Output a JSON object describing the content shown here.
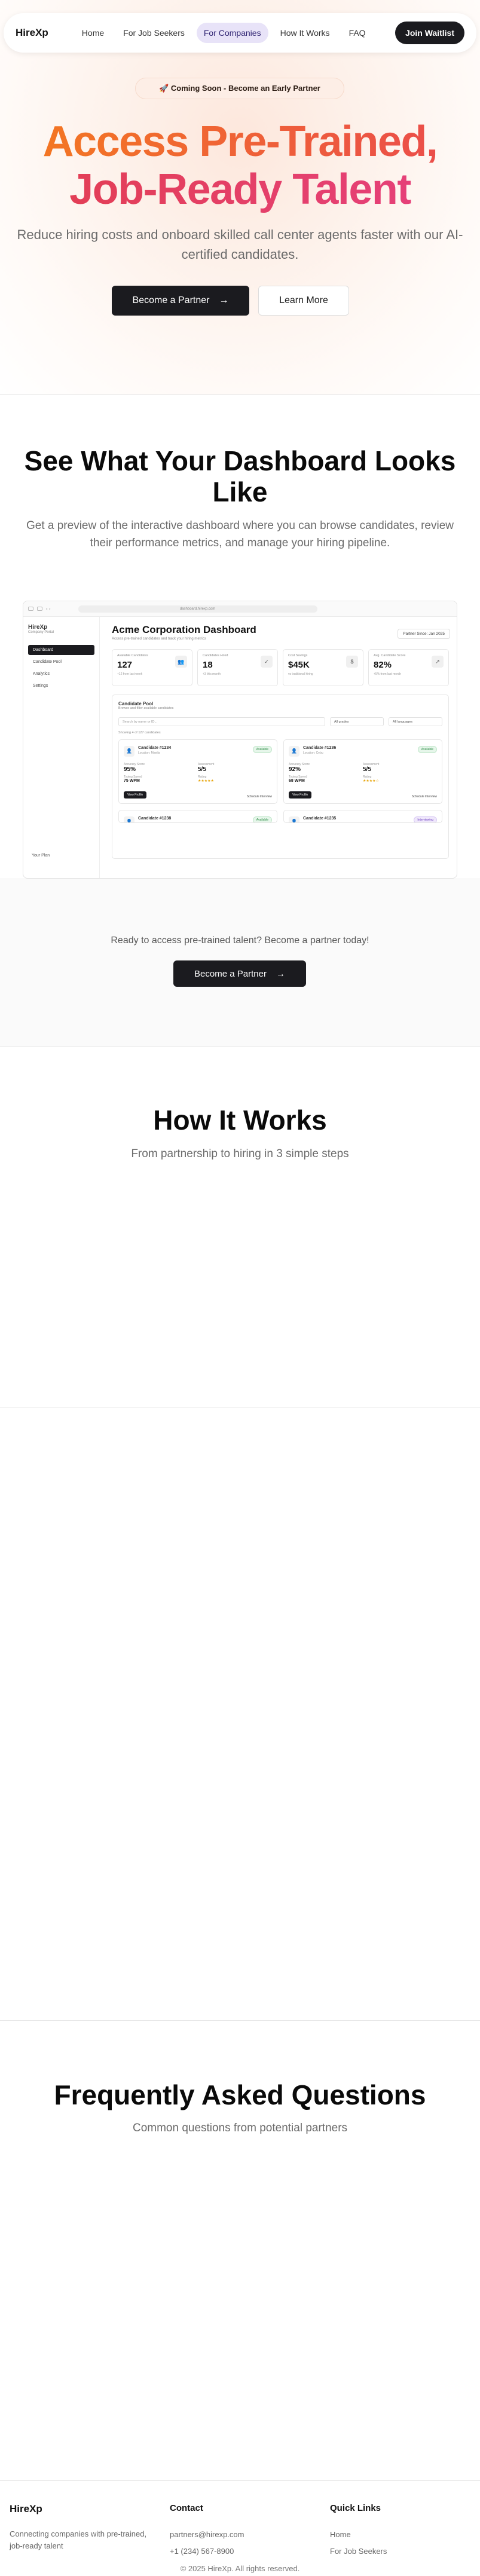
{
  "nav": {
    "brand": "HireXp",
    "links": [
      "Home",
      "For Job Seekers",
      "For Companies",
      "How It Works",
      "FAQ"
    ],
    "active_index": 2,
    "cta": "Join Waitlist"
  },
  "hero": {
    "badge_icon": "rocket-icon",
    "badge": "🚀 Coming Soon - Become an Early Partner",
    "title_line1": "Access Pre-Trained,",
    "title_line2": "Job-Ready Talent",
    "subtitle": "Reduce hiring costs and onboard skilled call center agents faster with our AI-certified candidates.",
    "primary_button": "Become a Partner",
    "secondary_button": "Learn More"
  },
  "dashboard_section": {
    "title_line1": "See What Your Dashboard Looks",
    "title_line2": "Like",
    "subtitle": "Get a preview of the interactive dashboard where you can browse candidates, review their performance metrics, and manage your hiring pipeline.",
    "preview": {
      "url": "dashboard.hirexp.com",
      "sidebar": {
        "brand": "HireXp",
        "sub": "Company Portal",
        "items": [
          "Dashboard",
          "Candidate Pool",
          "Analytics",
          "Settings"
        ],
        "footer": "Your Plan"
      },
      "title": "Acme Corporation Dashboard",
      "subtitle": "Access pre-trained candidates and track your hiring metrics",
      "partner_since": "Partner Since: Jan 2025",
      "stats": [
        {
          "label": "Available Candidates",
          "value": "127",
          "note": "+12 from last week",
          "icon": "users-icon"
        },
        {
          "label": "Candidates Hired",
          "value": "18",
          "note": "+3 this month",
          "icon": "user-check-icon"
        },
        {
          "label": "Cost Savings",
          "value": "$45K",
          "note": "vs traditional hiring",
          "icon": "dollar-icon"
        },
        {
          "label": "Avg. Candidate Score",
          "value": "82%",
          "note": "+5% from last month",
          "icon": "trend-up-icon"
        }
      ],
      "pool": {
        "title": "Candidate Pool",
        "sub": "Browse and filter available candidates",
        "search_placeholder": "Search by name or ID...",
        "filter1": "All grades",
        "filter2": "All languages",
        "showing": "Showing 4 of 127 candidates",
        "candidates": [
          {
            "name": "Candidate #1234",
            "location": "Location: Manila",
            "tag": "Available",
            "accuracy": "95%",
            "response": "5/5",
            "typing": "75 WPM",
            "rating": "★★★★★",
            "btn": "View Profile",
            "btn2": "Schedule Interview"
          },
          {
            "name": "Candidate #1236",
            "location": "Location: Cebu",
            "tag": "Available",
            "accuracy": "92%",
            "response": "5/5",
            "typing": "68 WPM",
            "rating": "★★★★☆",
            "btn": "View Profile",
            "btn2": "Schedule Interview"
          },
          {
            "name": "Candidate #1238",
            "tag": "Available"
          },
          {
            "name": "Candidate #1235",
            "tag": "Interviewing"
          }
        ],
        "labels": {
          "accuracy": "Accuracy Score",
          "response": "Assessment",
          "typing": "Typing Speed",
          "rating": "Rating"
        }
      }
    },
    "cta_text": "Ready to access pre-trained talent? Become a partner today!",
    "cta_button": "Become a Partner"
  },
  "how_it_works": {
    "title": "How It Works",
    "subtitle": "From partnership to hiring in 3 simple steps"
  },
  "faq": {
    "title": "Frequently Asked Questions",
    "subtitle": "Common questions from potential partners"
  },
  "footer": {
    "brand": "HireXp",
    "description": "Connecting companies with pre-trained, job-ready talent",
    "contact_heading": "Contact",
    "email": "partners@hirexp.com",
    "phone": "+1 (234) 567-8900",
    "links_heading": "Quick Links",
    "links": [
      "Home",
      "For Job Seekers"
    ],
    "copyright": "© 2025 HireXp. All rights reserved."
  }
}
